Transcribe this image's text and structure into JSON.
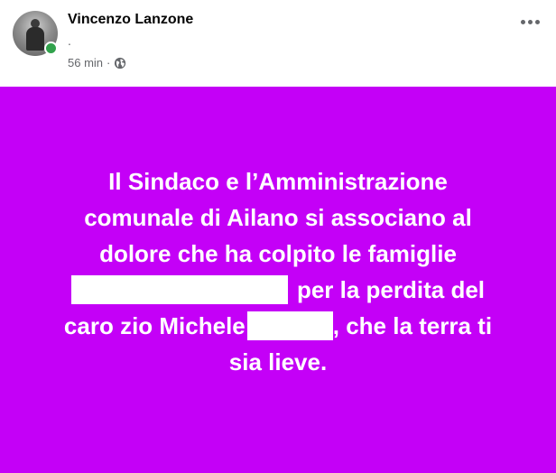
{
  "post": {
    "author": "Vincenzo Lanzone",
    "subtitle": ".",
    "time": "56 min",
    "separator": "·",
    "audience_icon": "globe-icon",
    "more_icon": "more-options-icon",
    "background_color": "#c400f7",
    "text_color": "#ffffff",
    "body": {
      "line1": "Il Sindaco e l’Amministrazione",
      "line2": "comunale di Ailano si associano al",
      "line3": "dolore che ha colpito le famiglie",
      "line4_after_redaction": "per la perdita del",
      "line5_before_redaction": "caro zio Michele",
      "line5_after_redaction": ", che la terra ti",
      "line6": "sia lieve."
    }
  }
}
